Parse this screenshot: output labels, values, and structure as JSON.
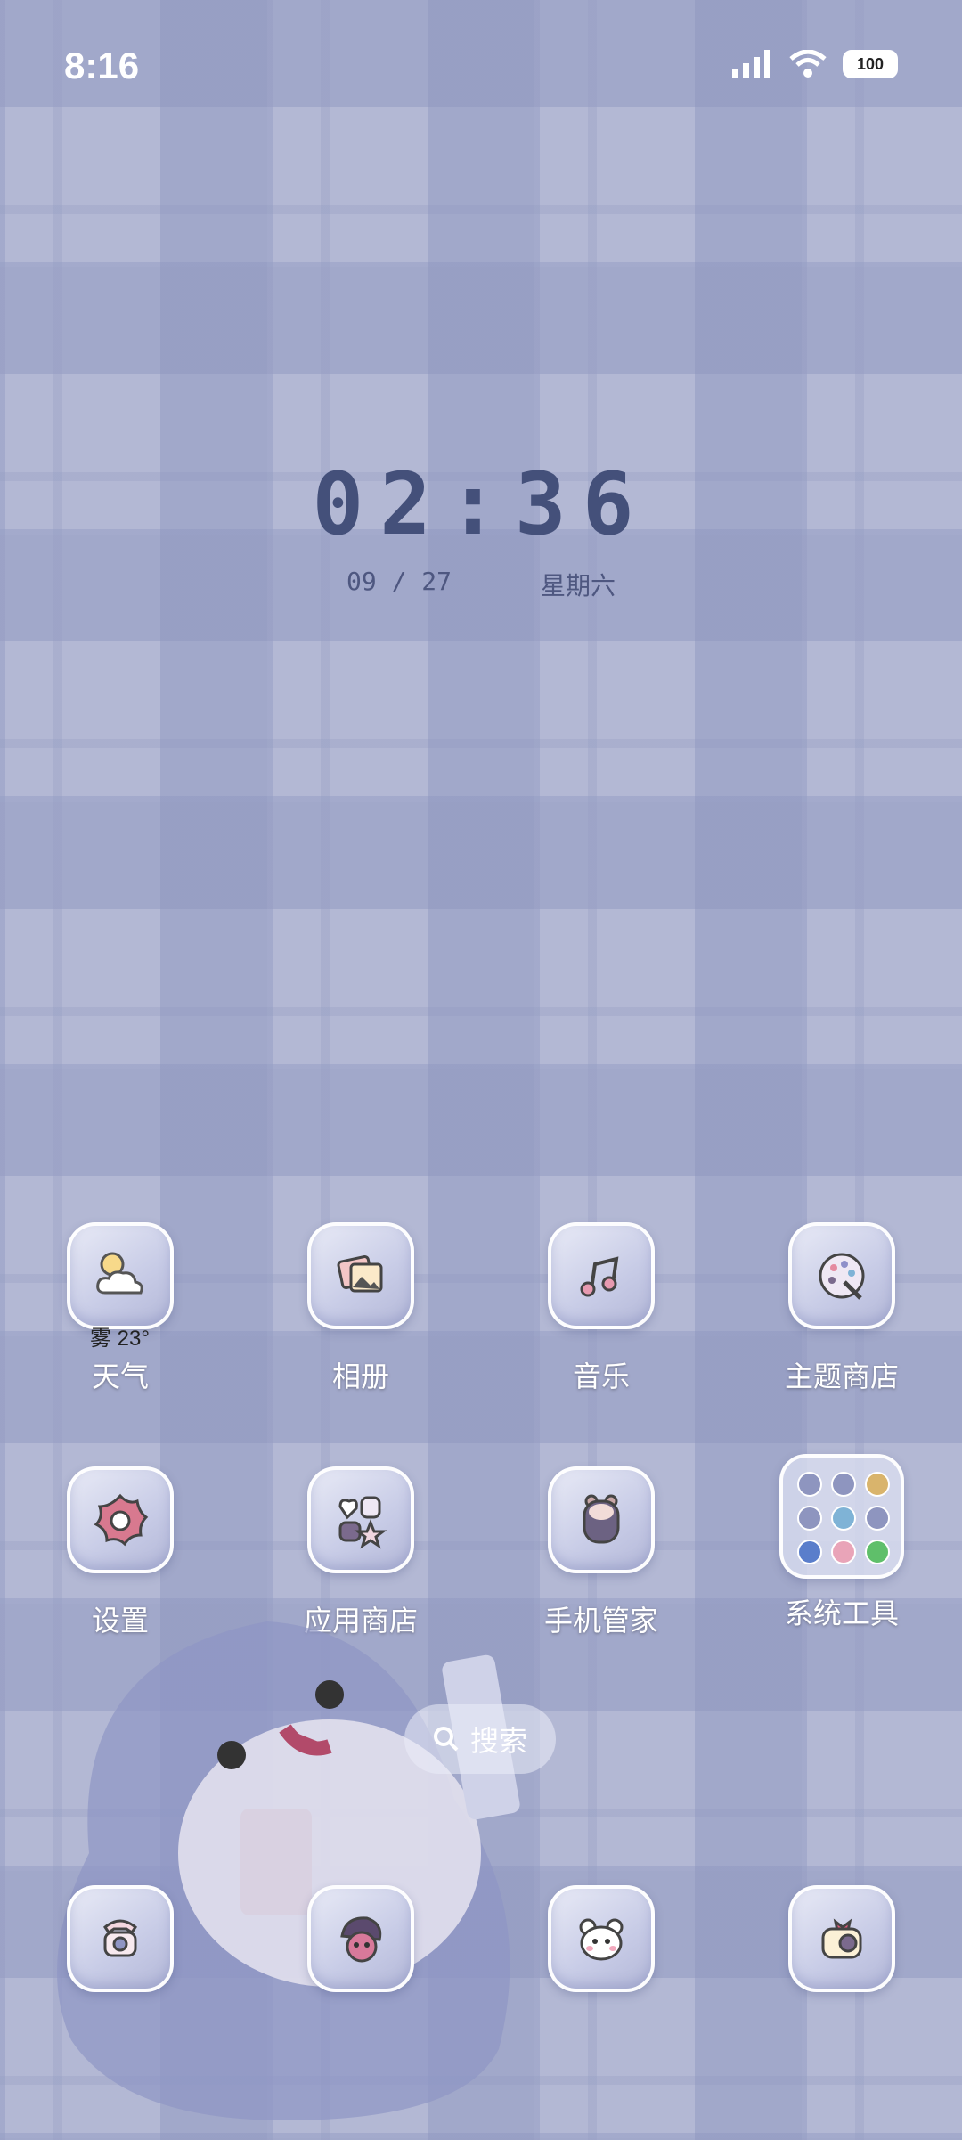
{
  "status_bar": {
    "time": "8:16",
    "battery": "100",
    "icons": [
      "signal-icon",
      "wifi-icon",
      "battery-icon"
    ]
  },
  "clock_widget": {
    "time": "02:36",
    "date": "09 / 27",
    "weekday": "星期六"
  },
  "row1": [
    {
      "name": "weather",
      "label": "天气",
      "icon": "sun-cloud-icon",
      "extra": "雾 23°"
    },
    {
      "name": "gallery",
      "label": "相册",
      "icon": "photo-icon"
    },
    {
      "name": "music",
      "label": "音乐",
      "icon": "music-note-icon"
    },
    {
      "name": "theme-store",
      "label": "主题商店",
      "icon": "palette-icon"
    }
  ],
  "row2": [
    {
      "name": "settings",
      "label": "设置",
      "icon": "flower-gear-icon"
    },
    {
      "name": "app-store",
      "label": "应用商店",
      "icon": "sticker-icon"
    },
    {
      "name": "phone-manager",
      "label": "手机管家",
      "icon": "bear-icon"
    },
    {
      "name": "system-tools",
      "label": "系统工具",
      "icon": "folder-icon"
    }
  ],
  "search": {
    "label": "搜索"
  },
  "dock": [
    {
      "name": "phone",
      "icon": "telephone-icon"
    },
    {
      "name": "messages",
      "icon": "character-icon"
    },
    {
      "name": "camera-bear",
      "icon": "bear-face-icon"
    },
    {
      "name": "camera",
      "icon": "camera-icon"
    }
  ]
}
